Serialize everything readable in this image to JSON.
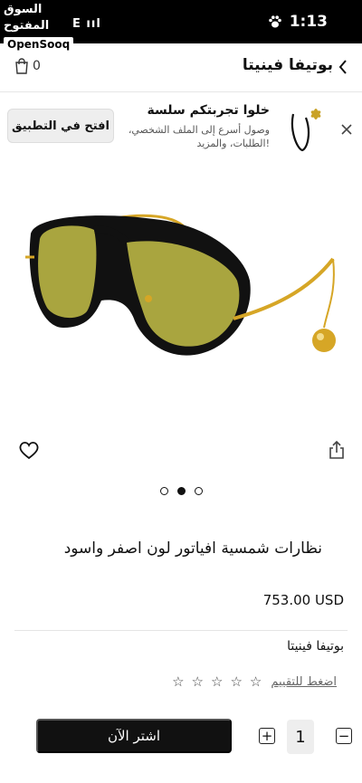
{
  "status_bar": {
    "time": "1:13",
    "watermark_arabic": "السوق المفتوح",
    "watermark_brand": "OpenSooq",
    "signal_text": "E"
  },
  "header": {
    "store_title": "بوتيفا فينيتا",
    "cart_count": "0"
  },
  "app_banner": {
    "title": "خلوا تجربتكم سلسة",
    "subtitle": "وصول أسرع إلى الملف الشخصي، الطلبات، والمزيد!",
    "open_button": "افتح في التطبيق"
  },
  "product": {
    "name": "نظارات شمسية افياتور لون اصفر واسود",
    "price": "753.00 USD",
    "brand": "بوتيفا فينيتا",
    "rating_link": "اضغط للتقييم",
    "stars_total": 5,
    "stars_filled": 0,
    "image_count": 3,
    "active_image_index": 1
  },
  "purchase": {
    "quantity": "1",
    "minus": "−",
    "plus": "+",
    "buy_button": "اشتر الآن"
  },
  "colors": {
    "lens": "#a9a53f",
    "frame": "#111111",
    "gold": "#d6a626",
    "button_dark": "#111111"
  }
}
